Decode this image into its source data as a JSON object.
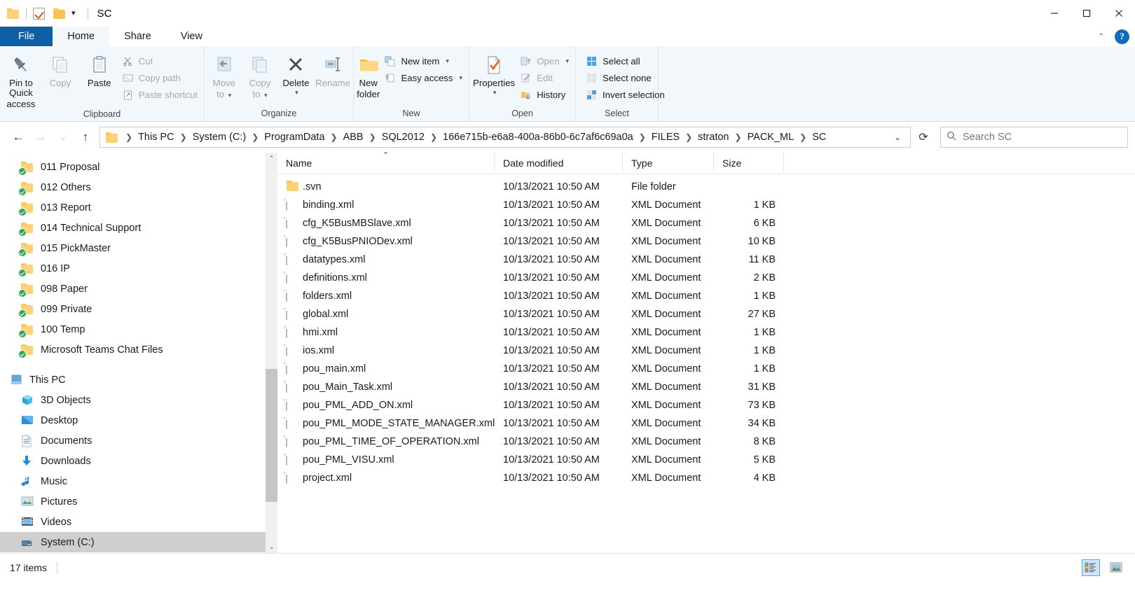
{
  "window": {
    "title": "SC",
    "quick_access": [
      {
        "name": "folder-icon",
        "label": "Folder"
      },
      {
        "name": "properties-check-icon",
        "label": "Properties"
      },
      {
        "name": "new-folder-icon",
        "label": "New folder"
      },
      {
        "name": "customize-caret-icon",
        "label": "Customize Quick Access Toolbar"
      }
    ],
    "controls": {
      "minimize": "Minimize",
      "maximize": "Maximize",
      "close": "Close"
    }
  },
  "tabs": [
    {
      "label": "File",
      "id": "file"
    },
    {
      "label": "Home",
      "id": "home"
    },
    {
      "label": "Share",
      "id": "share"
    },
    {
      "label": "View",
      "id": "view"
    }
  ],
  "tabstrip_right": {
    "collapse": "Collapse the Ribbon",
    "help": "?"
  },
  "ribbon": {
    "groups": [
      {
        "label": "Clipboard",
        "big": [
          {
            "label": "Pin to Quick",
            "label2": "access",
            "icon": "pin-icon",
            "dim": false
          },
          {
            "label": "Copy",
            "icon": "copy-icon",
            "dim": true
          },
          {
            "label": "Paste",
            "icon": "paste-icon",
            "dim": false
          }
        ],
        "small": [
          {
            "label": "Cut",
            "icon": "scissors-icon",
            "dim": true
          },
          {
            "label": "Copy path",
            "icon": "copy-path-icon",
            "dim": true
          },
          {
            "label": "Paste shortcut",
            "icon": "paste-shortcut-icon",
            "dim": true
          }
        ]
      },
      {
        "label": "Organize",
        "big": [
          {
            "label": "Move",
            "label2": "to",
            "icon": "move-to-icon",
            "dim": true,
            "caret": true
          },
          {
            "label": "Copy",
            "label2": "to",
            "icon": "copy-to-icon",
            "dim": true,
            "caret": true
          },
          {
            "label": "Delete",
            "icon": "delete-icon",
            "dim": false,
            "caret_below": true
          },
          {
            "label": "Rename",
            "icon": "rename-icon",
            "dim": true
          }
        ],
        "small": []
      },
      {
        "label": "New",
        "big": [
          {
            "label": "New",
            "label2": "folder",
            "icon": "new-folder-icon",
            "dim": false
          }
        ],
        "small": [
          {
            "label": "New item",
            "icon": "new-item-icon",
            "dim": false,
            "caret": true
          },
          {
            "label": "Easy access",
            "icon": "easy-access-icon",
            "dim": false,
            "caret": true
          }
        ]
      },
      {
        "label": "Open",
        "big": [
          {
            "label": "Properties",
            "icon": "properties-icon",
            "dim": false,
            "caret_below": true
          }
        ],
        "small": [
          {
            "label": "Open",
            "icon": "open-icon",
            "dim": true,
            "caret": true
          },
          {
            "label": "Edit",
            "icon": "edit-icon",
            "dim": true
          },
          {
            "label": "History",
            "icon": "history-icon",
            "dim": false
          }
        ]
      },
      {
        "label": "Select",
        "big": [],
        "small": [
          {
            "label": "Select all",
            "icon": "select-all-icon",
            "dim": false
          },
          {
            "label": "Select none",
            "icon": "select-none-icon",
            "dim": false
          },
          {
            "label": "Invert selection",
            "icon": "invert-selection-icon",
            "dim": false
          }
        ]
      }
    ]
  },
  "addressbar": {
    "back": "Back",
    "forward": "Forward",
    "recent": "Recent locations",
    "up": "Up",
    "crumbs": [
      "This PC",
      "System (C:)",
      "ProgramData",
      "ABB",
      "SQL2012",
      "166e715b-e6a8-400a-86b0-6c7af6c69a0a",
      "FILES",
      "straton",
      "PACK_ML",
      "SC"
    ],
    "refresh": "Refresh",
    "search_placeholder": "Search SC",
    "search_value": ""
  },
  "sidebar": {
    "items": [
      {
        "label": "011 Proposal",
        "icon": "folder-sync-icon",
        "indent": 1,
        "selected": false
      },
      {
        "label": "012 Others",
        "icon": "folder-sync-icon",
        "indent": 1,
        "selected": false
      },
      {
        "label": "013 Report",
        "icon": "folder-sync-icon",
        "indent": 1,
        "selected": false
      },
      {
        "label": "014 Technical Support",
        "icon": "folder-sync-icon",
        "indent": 1,
        "selected": false
      },
      {
        "label": "015 PickMaster",
        "icon": "folder-sync-icon",
        "indent": 1,
        "selected": false
      },
      {
        "label": "016 IP",
        "icon": "folder-sync-icon",
        "indent": 1,
        "selected": false
      },
      {
        "label": "098 Paper",
        "icon": "folder-sync-icon",
        "indent": 1,
        "selected": false
      },
      {
        "label": "099 Private",
        "icon": "folder-sync-icon",
        "indent": 1,
        "selected": false
      },
      {
        "label": "100 Temp",
        "icon": "folder-sync-icon",
        "indent": 1,
        "selected": false
      },
      {
        "label": "Microsoft Teams Chat Files",
        "icon": "folder-sync-icon",
        "indent": 1,
        "selected": false
      },
      {
        "gap": true
      },
      {
        "label": "This PC",
        "icon": "this-pc-icon",
        "indent": 0,
        "selected": false
      },
      {
        "label": "3D Objects",
        "icon": "3d-objects-icon",
        "indent": 1,
        "selected": false
      },
      {
        "label": "Desktop",
        "icon": "desktop-icon",
        "indent": 1,
        "selected": false
      },
      {
        "label": "Documents",
        "icon": "documents-icon",
        "indent": 1,
        "selected": false
      },
      {
        "label": "Downloads",
        "icon": "downloads-icon",
        "indent": 1,
        "selected": false
      },
      {
        "label": "Music",
        "icon": "music-icon",
        "indent": 1,
        "selected": false
      },
      {
        "label": "Pictures",
        "icon": "pictures-icon",
        "indent": 1,
        "selected": false
      },
      {
        "label": "Videos",
        "icon": "videos-icon",
        "indent": 1,
        "selected": false
      },
      {
        "label": "System (C:)",
        "icon": "drive-icon",
        "indent": 1,
        "selected": true
      }
    ]
  },
  "filelist": {
    "columns": [
      {
        "label": "Name",
        "sorted": "asc"
      },
      {
        "label": "Date modified",
        "sorted": ""
      },
      {
        "label": "Type",
        "sorted": ""
      },
      {
        "label": "Size",
        "sorted": ""
      }
    ],
    "rows": [
      {
        "name": ".svn",
        "date": "10/13/2021 10:50 AM",
        "type": "File folder",
        "size": "",
        "icon": "folder-icon"
      },
      {
        "name": "binding.xml",
        "date": "10/13/2021 10:50 AM",
        "type": "XML Document",
        "size": "1 KB",
        "icon": "xml-file-icon"
      },
      {
        "name": "cfg_K5BusMBSlave.xml",
        "date": "10/13/2021 10:50 AM",
        "type": "XML Document",
        "size": "6 KB",
        "icon": "xml-file-icon"
      },
      {
        "name": "cfg_K5BusPNIODev.xml",
        "date": "10/13/2021 10:50 AM",
        "type": "XML Document",
        "size": "10 KB",
        "icon": "xml-file-icon"
      },
      {
        "name": "datatypes.xml",
        "date": "10/13/2021 10:50 AM",
        "type": "XML Document",
        "size": "11 KB",
        "icon": "xml-file-icon"
      },
      {
        "name": "definitions.xml",
        "date": "10/13/2021 10:50 AM",
        "type": "XML Document",
        "size": "2 KB",
        "icon": "xml-file-icon"
      },
      {
        "name": "folders.xml",
        "date": "10/13/2021 10:50 AM",
        "type": "XML Document",
        "size": "1 KB",
        "icon": "xml-file-icon"
      },
      {
        "name": "global.xml",
        "date": "10/13/2021 10:50 AM",
        "type": "XML Document",
        "size": "27 KB",
        "icon": "xml-file-icon"
      },
      {
        "name": "hmi.xml",
        "date": "10/13/2021 10:50 AM",
        "type": "XML Document",
        "size": "1 KB",
        "icon": "xml-file-icon"
      },
      {
        "name": "ios.xml",
        "date": "10/13/2021 10:50 AM",
        "type": "XML Document",
        "size": "1 KB",
        "icon": "xml-file-icon"
      },
      {
        "name": "pou_main.xml",
        "date": "10/13/2021 10:50 AM",
        "type": "XML Document",
        "size": "1 KB",
        "icon": "xml-file-icon"
      },
      {
        "name": "pou_Main_Task.xml",
        "date": "10/13/2021 10:50 AM",
        "type": "XML Document",
        "size": "31 KB",
        "icon": "xml-file-icon"
      },
      {
        "name": "pou_PML_ADD_ON.xml",
        "date": "10/13/2021 10:50 AM",
        "type": "XML Document",
        "size": "73 KB",
        "icon": "xml-file-icon"
      },
      {
        "name": "pou_PML_MODE_STATE_MANAGER.xml",
        "date": "10/13/2021 10:50 AM",
        "type": "XML Document",
        "size": "34 KB",
        "icon": "xml-file-icon"
      },
      {
        "name": "pou_PML_TIME_OF_OPERATION.xml",
        "date": "10/13/2021 10:50 AM",
        "type": "XML Document",
        "size": "8 KB",
        "icon": "xml-file-icon"
      },
      {
        "name": "pou_PML_VISU.xml",
        "date": "10/13/2021 10:50 AM",
        "type": "XML Document",
        "size": "5 KB",
        "icon": "xml-file-icon"
      },
      {
        "name": "project.xml",
        "date": "10/13/2021 10:50 AM",
        "type": "XML Document",
        "size": "4 KB",
        "icon": "xml-file-icon"
      }
    ]
  },
  "statusbar": {
    "item_count": "17 items",
    "views": [
      {
        "name": "details-view-button",
        "active": true
      },
      {
        "name": "large-icons-view-button",
        "active": false
      }
    ]
  },
  "colors": {
    "accent": "#0f5fa6",
    "ribbon_bg": "#f2f7fb",
    "selection": "#cfcfcf",
    "folder": "#fbd277",
    "sync_green": "#2fa84f"
  }
}
